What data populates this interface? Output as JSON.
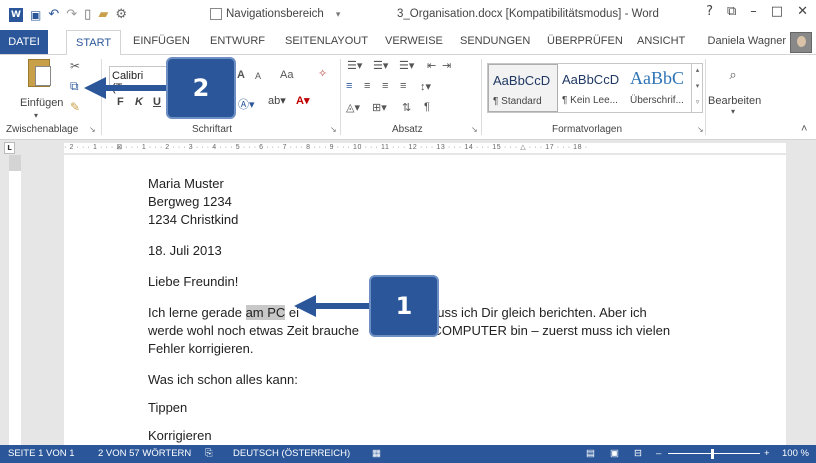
{
  "titlebar": {
    "app_icon": "W",
    "nav_pane_label": "Navigationsbereich",
    "window_title": "3_Organisation.docx [Kompatibilitätsmodus] - Word",
    "controls": [
      "?",
      "⧉",
      "–",
      "□",
      "✕"
    ]
  },
  "tabs": [
    {
      "label": "DATEI"
    },
    {
      "label": "START"
    },
    {
      "label": "EINFÜGEN"
    },
    {
      "label": "ENTWURF"
    },
    {
      "label": "SEITENLAYOUT"
    },
    {
      "label": "VERWEISE"
    },
    {
      "label": "SENDUNGEN"
    },
    {
      "label": "ÜBERPRÜFEN"
    },
    {
      "label": "ANSICHT"
    }
  ],
  "user": "Daniela Wagner",
  "ribbon": {
    "paste_label": "Einfügen",
    "font_name": "Calibri (Tex",
    "bold": "F",
    "italic": "K",
    "underline": "U",
    "font_grow": "A",
    "font_shrink": "A",
    "case": "Aa",
    "groups": {
      "clipboard": "Zwischenablage",
      "font": "Schriftart",
      "paragraph": "Absatz",
      "styles": "Formatvorlagen"
    },
    "styles": [
      {
        "sample": "AaBbCcD",
        "name": "¶ Standard"
      },
      {
        "sample": "AaBbCcD",
        "name": "¶ Kein Lee..."
      },
      {
        "sample": "AaBbC",
        "name": "Überschrif..."
      }
    ],
    "editing_label": "Bearbeiten"
  },
  "ruler": {
    "corner": "L",
    "marks": "· 2 · · · 1 · · · ⊠ · · · 1 · · · 2 · · · 3 · · · 4 · · · 5 · · · 6 · · · 7 · · · 8 · · · 9 · · · 10 · · · 11 · · · 12 · · · 13 · · · 14 · · · 15 · · · △ · · · 17 · · · 18 ·"
  },
  "document": {
    "address": [
      "Maria Muster",
      "Bergweg 1234",
      "1234 Christkind"
    ],
    "date": "18. Juli 2013",
    "greeting": "Liebe Freundin!",
    "para_line1_pre": "Ich lerne gerade ",
    "para_line1_sel": "am PC",
    "para_line1_mid": " ei",
    "para_line1_post": "as muss ich Dir gleich berichten. Aber ich",
    "para_line2_pre": "werde wohl noch etwas Zeit brauche",
    "para_line2_post": "m COMPUTER bin – zuerst muss ich vielen",
    "para_line3": "Fehler korrigieren.",
    "list_intro": "Was ich schon alles kann:",
    "items": [
      "Tippen",
      "Korrigieren"
    ]
  },
  "status": {
    "page": "SEITE 1 VON 1",
    "words": "2 VON 57 WÖRTERN",
    "language": "DEUTSCH (ÖSTERREICH)",
    "zoom": "100 %"
  },
  "callouts": {
    "one": "1",
    "two": "2"
  },
  "colors": {
    "accent": "#2b579a"
  }
}
